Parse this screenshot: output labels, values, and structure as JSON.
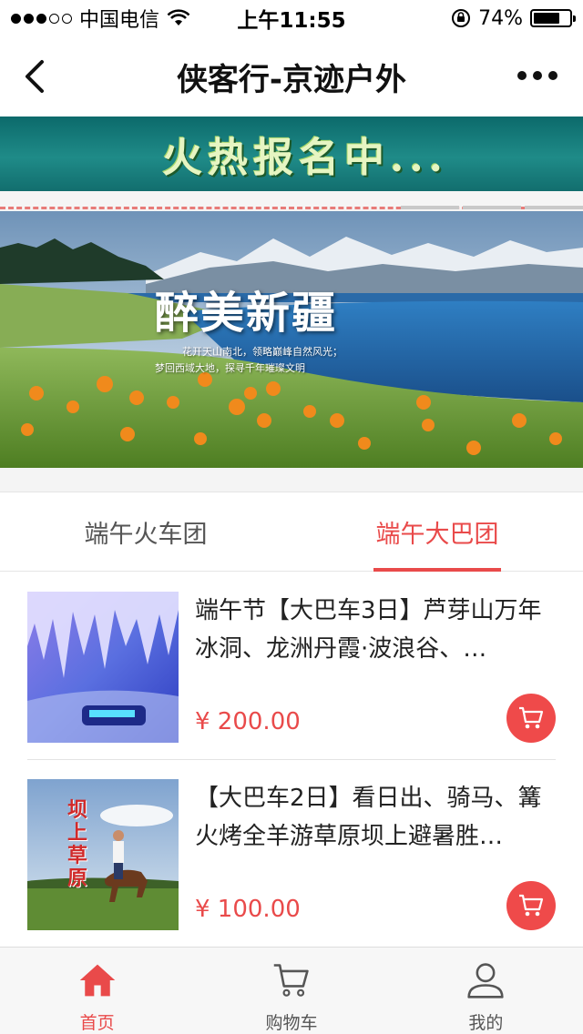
{
  "status_bar": {
    "carrier": "中国电信",
    "time": "上午11:55",
    "battery": "74%",
    "battery_level": 0.74,
    "signal_filled": 3,
    "signal_total": 5
  },
  "nav": {
    "title": "侠客行-京迹户外",
    "back_icon": "back-chevron-icon",
    "more_icon": "more-dots-icon"
  },
  "banner": {
    "top_text": "火热报名中...",
    "image_title": "醉美新疆",
    "image_line1": "花开天山南北，领略巅峰自然风光；",
    "image_line2": "梦回西域大地，探寻千年璀璨文明"
  },
  "tabs": [
    {
      "label": "端午火车团",
      "active": false
    },
    {
      "label": "端午大巴团",
      "active": true
    }
  ],
  "products": [
    {
      "title": "端午节【大巴车3日】芦芽山万年冰洞、龙洲丹霞·波浪谷、…",
      "price": "¥ 200.00",
      "thumb": "ice-cave"
    },
    {
      "title": "【大巴车2日】看日出、骑马、篝火烤全羊游草原坝上避暑胜…",
      "price": "¥ 100.00",
      "thumb": "grassland-horse",
      "thumb_text": "坝上草原"
    }
  ],
  "tabbar": [
    {
      "label": "首页",
      "icon": "home-icon",
      "active": true
    },
    {
      "label": "购物车",
      "icon": "cart-icon",
      "active": false
    },
    {
      "label": "我的",
      "icon": "user-icon",
      "active": false
    }
  ],
  "colors": {
    "accent": "#e94a4a",
    "text": "#222222",
    "muted": "#555555"
  }
}
